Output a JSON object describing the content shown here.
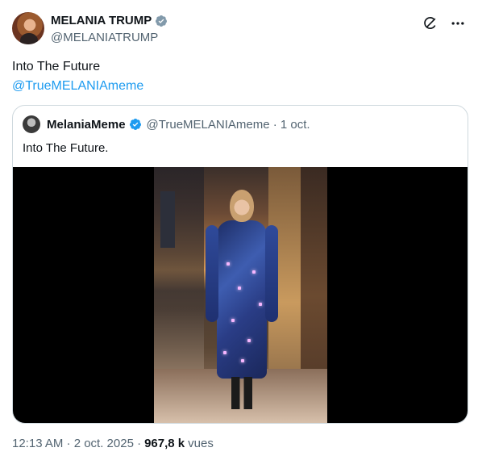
{
  "author": {
    "display_name": "MELANIA TRUMP",
    "handle": "@MELANIATRUMP",
    "verified_badge_color": "#829aab"
  },
  "actions": {
    "grok_icon": "grok-icon",
    "more_icon": "more-horizontal-icon"
  },
  "tweet": {
    "text": "Into The Future",
    "mention": "@TrueMELANIAmeme"
  },
  "quote": {
    "display_name": "MelaniaMeme",
    "verified_badge_color": "#1d9bf0",
    "meta": "@TrueMELANIAmeme · 1 oct.",
    "text": "Into The Future."
  },
  "footer": {
    "timestamp": "12:13 AM · 2 oct. 2025 ·",
    "views_count": "967,8 k",
    "views_label": "vues"
  },
  "colors": {
    "accent": "#1d9bf0",
    "secondary_text": "#536471",
    "border": "#cfd9de"
  }
}
